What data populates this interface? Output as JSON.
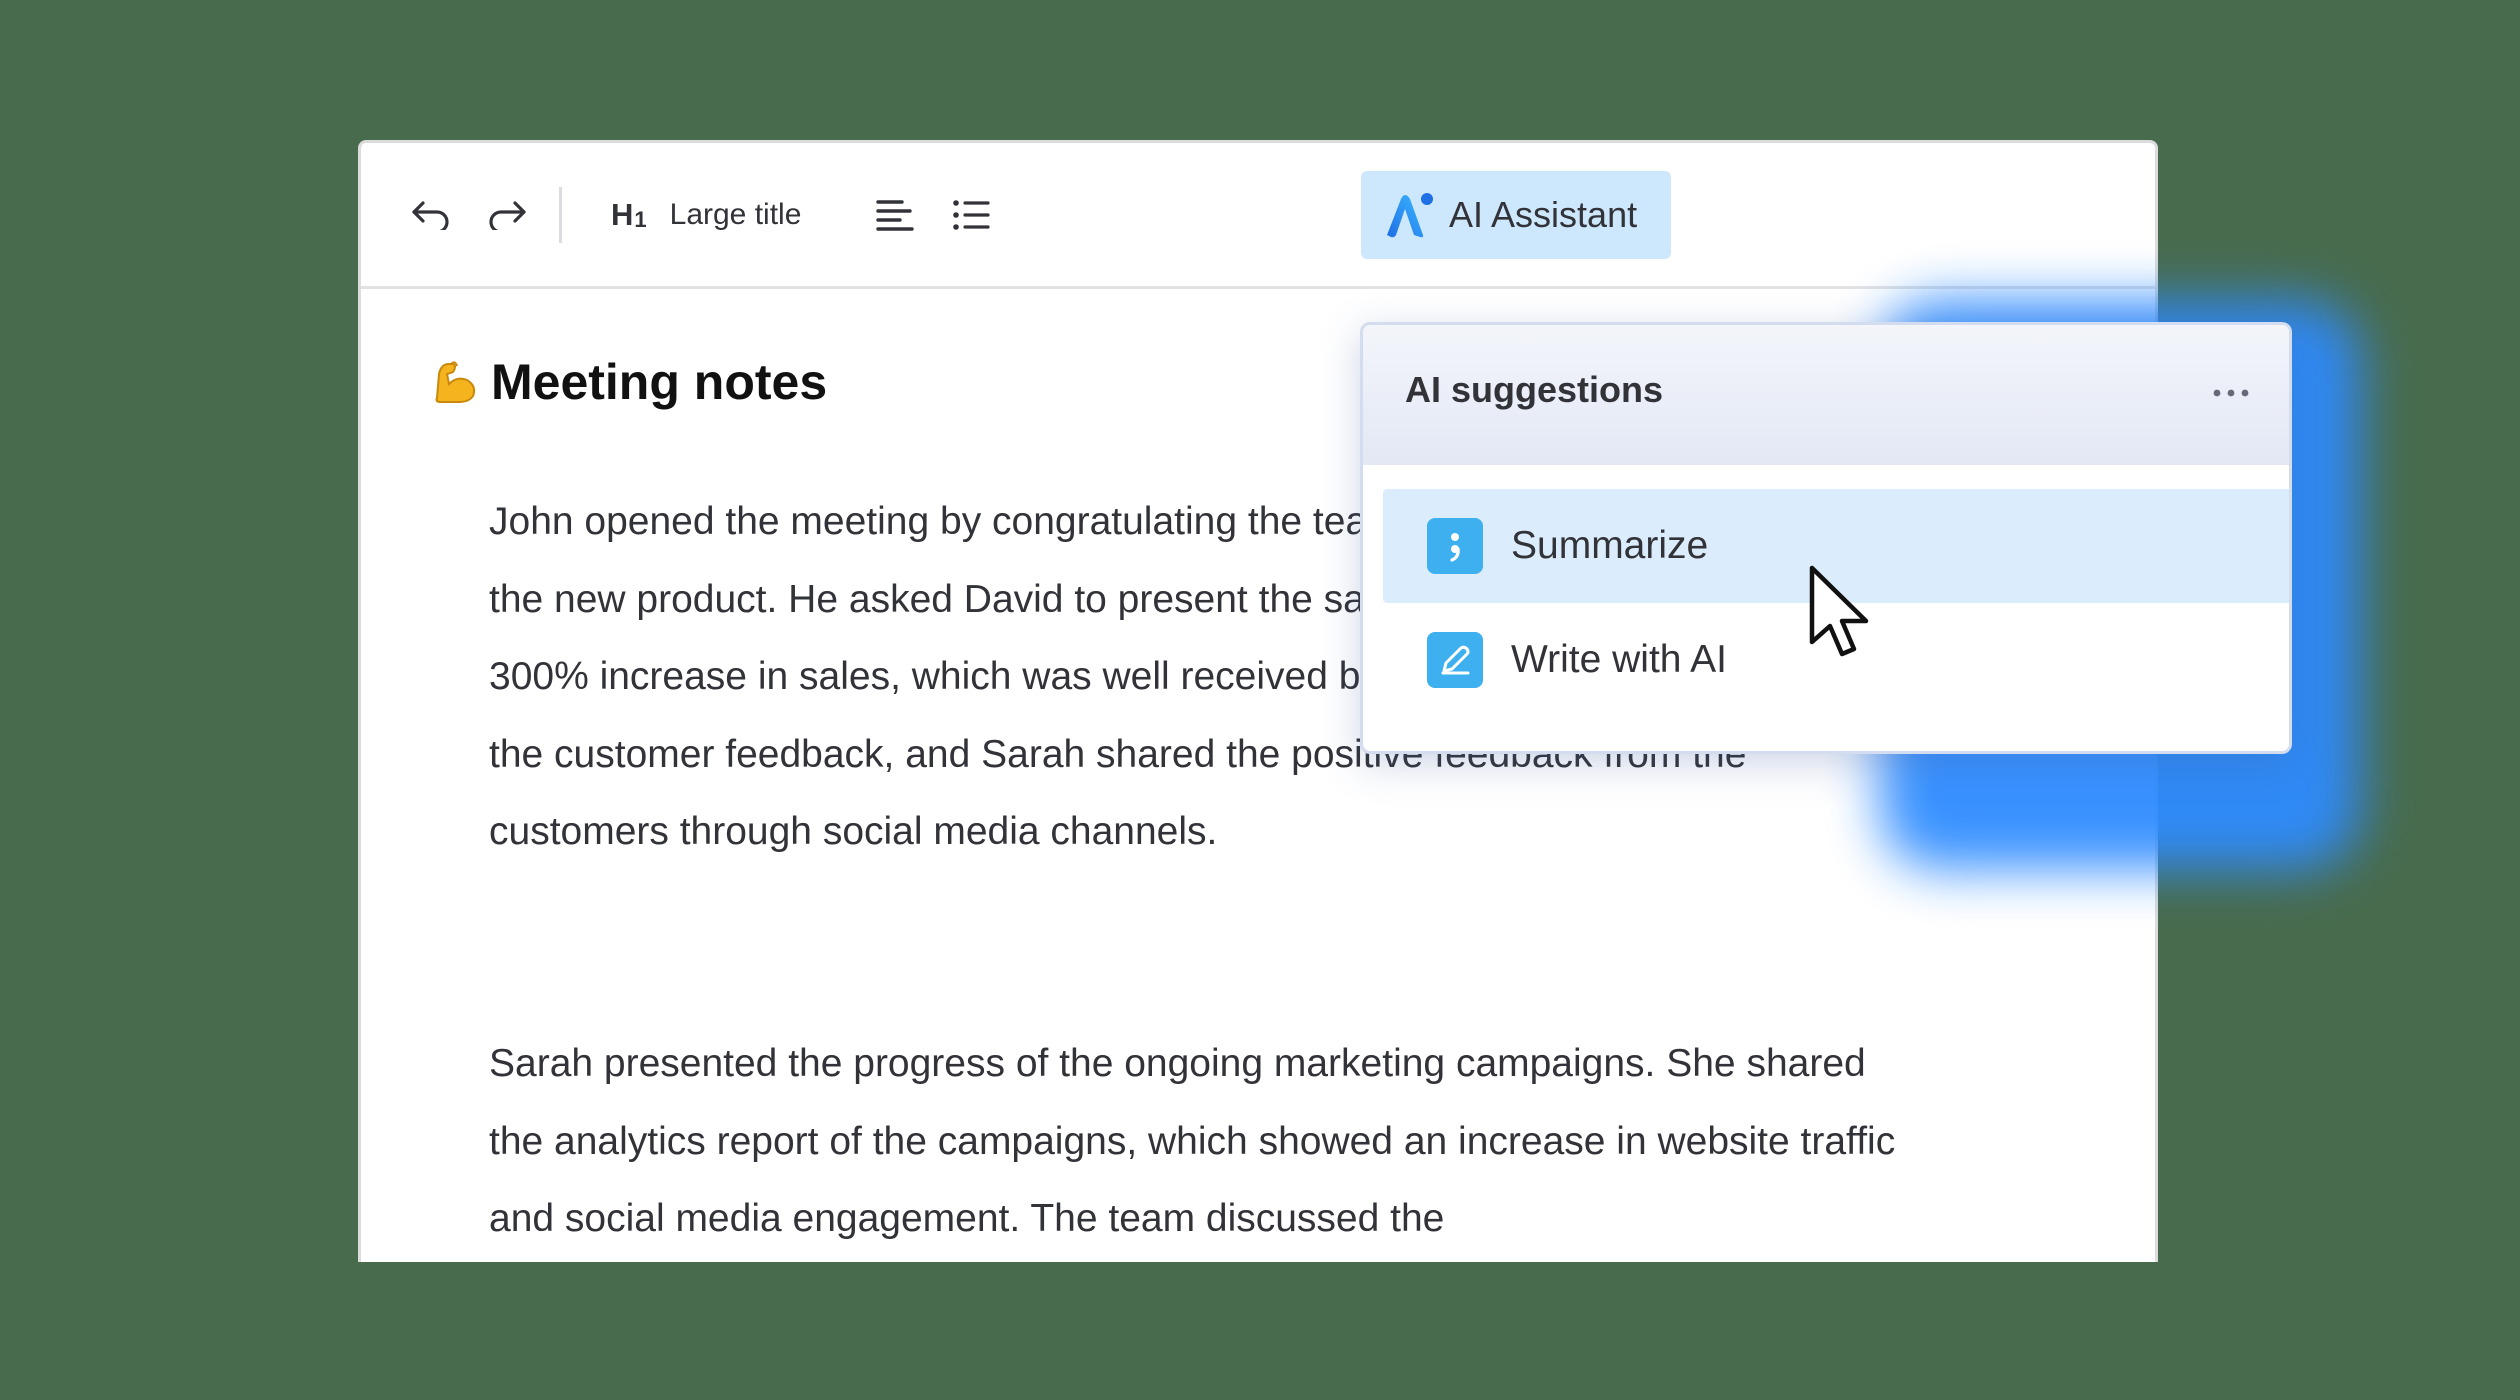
{
  "toolbar": {
    "undo_icon": "undo-icon",
    "redo_icon": "redo-icon",
    "heading_glyph": "H",
    "heading_glyph_sub": "1",
    "heading_label": "Large title",
    "align_icon": "align-left-icon",
    "list_icon": "bulleted-list-icon",
    "ai_button_label": "AI Assistant"
  },
  "document": {
    "title_emoji": "💪",
    "title": "Meeting notes",
    "paragraphs": [
      "John opened the meeting by congratulating the team on the successful launch of the new product. He asked David to present the sales figures. David reported a 300% increase in sales, which was well received by the team. Mary asked about the customer feedback, and Sarah shared the positive feedback from the customers through social media channels.",
      "Sarah presented the progress of the ongoing marketing campaigns. She shared the analytics report of the campaigns, which showed an increase in website traffic and social media engagement. The team discussed the"
    ]
  },
  "ai_popup": {
    "title": "AI suggestions",
    "more_icon": "more-horizontal-icon",
    "items": [
      {
        "label": "Summarize",
        "icon": "summarize-icon",
        "state": "hovered"
      },
      {
        "label": "Write with AI",
        "icon": "pencil-icon",
        "state": "default"
      }
    ]
  },
  "colors": {
    "background": "#486b4d",
    "ai_button_bg": "#cde7fd",
    "hover_row_bg": "#dbedfc",
    "item_icon_bg": "#3fb0ef",
    "glow": "#2f8cff",
    "text": "#323338"
  }
}
